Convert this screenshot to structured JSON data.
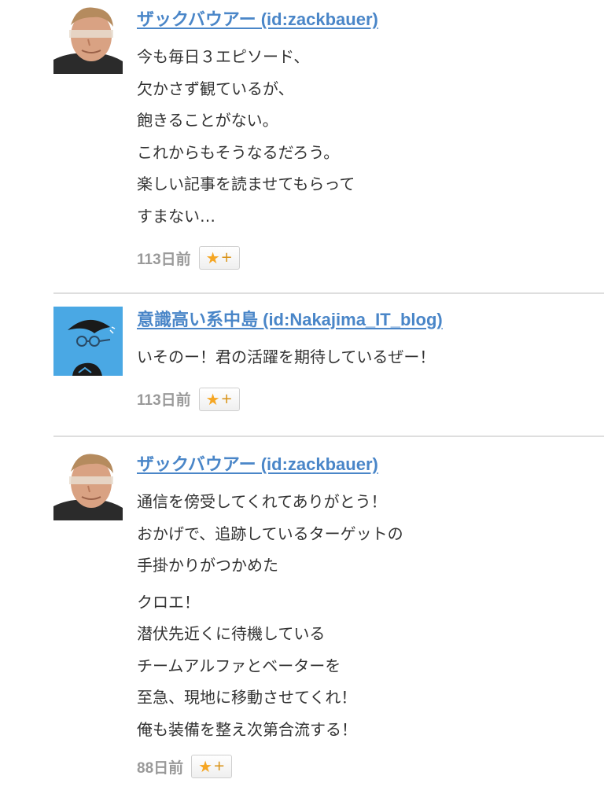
{
  "comments": [
    {
      "author": "ザックバウアー (id:zackbauer)",
      "paragraphs": [
        "今も毎日３エピソード、\n欠かさず観ているが、\n飽きることがない。\nこれからもそうなるだろう。\n楽しい記事を読ませてもらって\nすまない…"
      ],
      "time": "113日前",
      "avatar_icon": "man-portrait-avatar"
    },
    {
      "author": "意識高い系中島 (id:Nakajima_IT_blog)",
      "paragraphs": [
        "いそのー！君の活躍を期待しているぜー！"
      ],
      "time": "113日前",
      "avatar_icon": "glasses-character-avatar"
    },
    {
      "author": "ザックバウアー (id:zackbauer)",
      "paragraphs": [
        "通信を傍受してくれてありがとう！\nおかげで、追跡しているターゲットの\n手掛かりがつかめた",
        "クロエ！\n潜伏先近くに待機している\nチームアルファとベーターを\n至急、現地に移動させてくれ！\n俺も装備を整え次第合流する！"
      ],
      "time": "88日前",
      "avatar_icon": "man-portrait-avatar"
    }
  ],
  "star_button": {
    "star_glyph": "★",
    "plus_glyph": "+"
  },
  "colors": {
    "link": "#4a86c8",
    "star": "#f5a623",
    "time": "#9a9a9a",
    "text": "#333333",
    "avatar_blue_bg": "#4aa8e4"
  }
}
